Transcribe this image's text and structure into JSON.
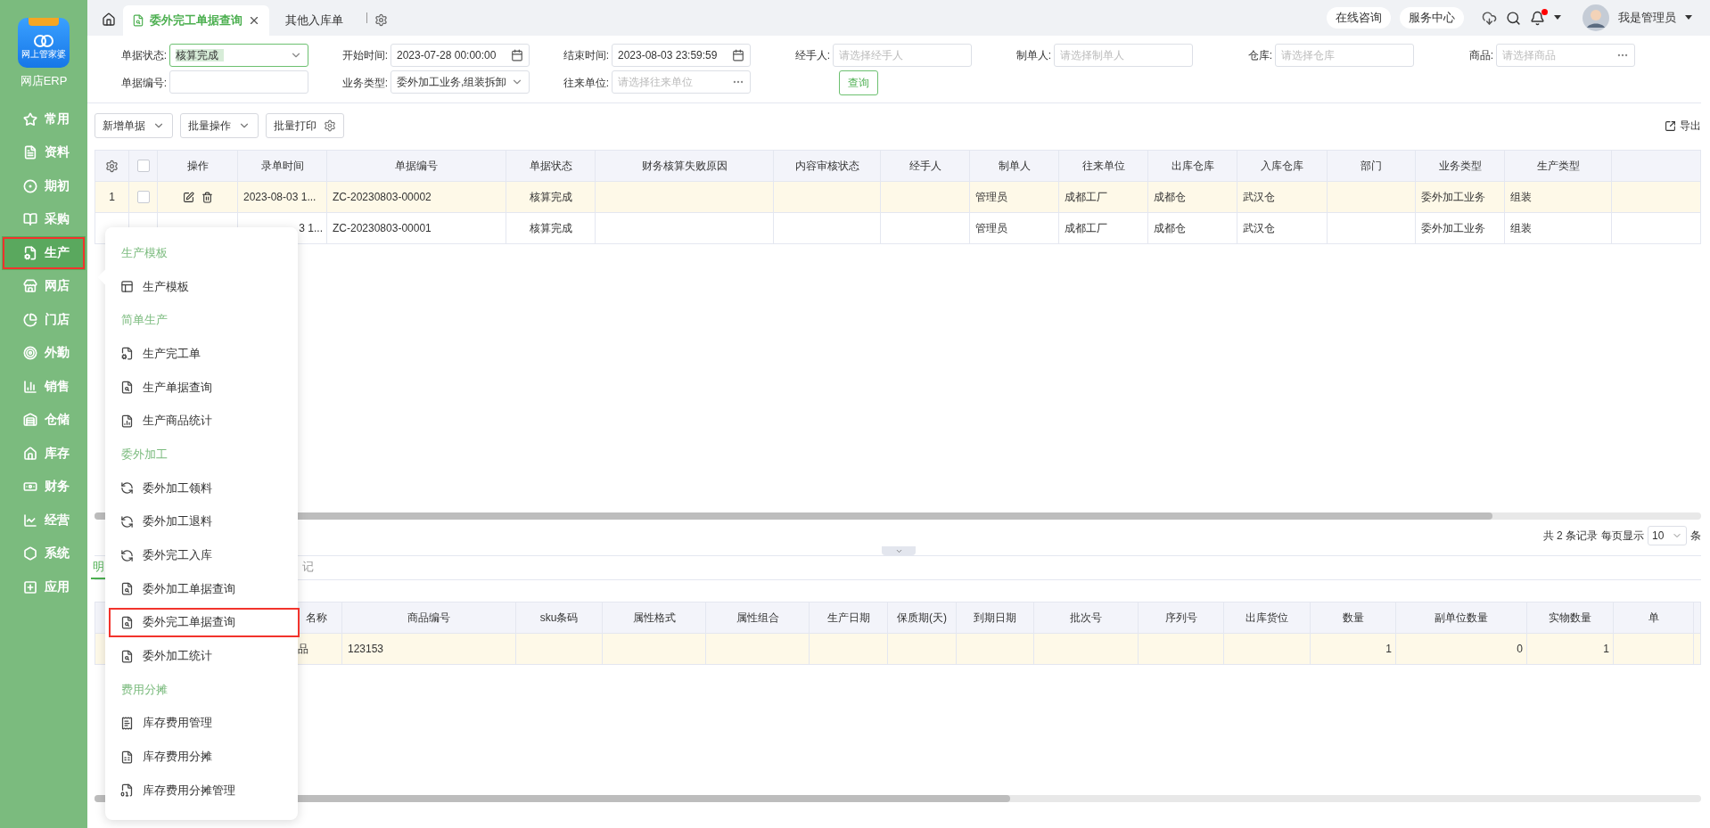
{
  "sidebar": {
    "logo_caption": "网上管家婆",
    "app_name": "网店ERP",
    "items": [
      {
        "label": "常用",
        "selected": false,
        "highlighted": false
      },
      {
        "label": "资料",
        "selected": false,
        "highlighted": false
      },
      {
        "label": "期初",
        "selected": false,
        "highlighted": false
      },
      {
        "label": "采购",
        "selected": false,
        "highlighted": false
      },
      {
        "label": "生产",
        "selected": true,
        "highlighted": true
      },
      {
        "label": "网店",
        "selected": false,
        "highlighted": false
      },
      {
        "label": "门店",
        "selected": false,
        "highlighted": false
      },
      {
        "label": "外勤",
        "selected": false,
        "highlighted": false
      },
      {
        "label": "销售",
        "selected": false,
        "highlighted": false
      },
      {
        "label": "仓储",
        "selected": false,
        "highlighted": false
      },
      {
        "label": "库存",
        "selected": false,
        "highlighted": false
      },
      {
        "label": "财务",
        "selected": false,
        "highlighted": false
      },
      {
        "label": "经营",
        "selected": false,
        "highlighted": false
      },
      {
        "label": "系统",
        "selected": false,
        "highlighted": false
      },
      {
        "label": "应用",
        "selected": false,
        "highlighted": false
      }
    ]
  },
  "tabs": [
    {
      "label": "委外完工单据查询",
      "selected": true
    },
    {
      "label": "其他入库单",
      "selected": false
    }
  ],
  "header": {
    "buttons": [
      "在线咨询",
      "服务中心"
    ],
    "user": "我是管理员",
    "notification": true
  },
  "filters": [
    {
      "label": "单据状态:",
      "kind": "select",
      "value": "核算完成"
    },
    {
      "label": "开始时间:",
      "kind": "date",
      "value": "2023-07-28 00:00:00"
    },
    {
      "label": "结束时间:",
      "kind": "date",
      "value": "2023-08-03 23:59:59"
    },
    {
      "label": "经手人:",
      "kind": "text",
      "placeholder": "请选择经手人"
    },
    {
      "label": "制单人:",
      "kind": "text",
      "placeholder": "请选择制单人"
    },
    {
      "label": "仓库:",
      "kind": "text",
      "placeholder": "请选择仓库"
    },
    {
      "label": "商品:",
      "kind": "picker",
      "placeholder": "请选择商品"
    },
    {
      "label": "单据编号:",
      "kind": "text"
    },
    {
      "label": "业务类型:",
      "kind": "select",
      "value": "委外加工业务,组装拆卸"
    },
    {
      "label": "往来单位:",
      "kind": "picker",
      "placeholder": "请选择往来单位"
    }
  ],
  "query_button": "查询",
  "toolbar": [
    {
      "label": "新增单据",
      "kind": "dropdown"
    },
    {
      "label": "批量操作",
      "kind": "dropdown"
    },
    {
      "label": "批量打印",
      "kind": "settings"
    }
  ],
  "export": "导出",
  "table": {
    "header_checked": false,
    "columns": [
      "操作",
      "录单时间",
      "单据编号",
      "单据状态",
      "财务核算失败原因",
      "内容审核状态",
      "经手人",
      "制单人",
      "往来单位",
      "出库仓库",
      "入库仓库",
      "部门",
      "业务类型",
      "生产类型"
    ],
    "rows": [
      {
        "index": "1",
        "checked": false,
        "actions": true,
        "selected": true,
        "clipped": false,
        "cells": [
          null,
          "2023-08-03 1...",
          "ZC-20230803-00002",
          "核算完成",
          null,
          null,
          null,
          "管理员",
          "成都工厂",
          "成都仓",
          "武汉仓",
          null,
          "委外加工业务",
          "组装"
        ]
      },
      {
        "selected": false,
        "clipped": true,
        "cells": [
          null,
          "3 1...",
          "ZC-20230803-00001",
          "核算完成",
          null,
          null,
          null,
          "管理员",
          "成都工厂",
          "成都仓",
          "武汉仓",
          null,
          "委外加工业务",
          "组装"
        ]
      }
    ]
  },
  "pagination": {
    "total": "共 2 条记录",
    "per_page_label": "每页显示",
    "per_page": "10",
    "unit": "条"
  },
  "detail_tabs": [
    {
      "label": "明",
      "selected": true
    },
    {
      "label": "记",
      "selected": false
    }
  ],
  "detail_table": {
    "columns": [
      "名称",
      "商品编号",
      "sku条码",
      "属性格式",
      "属性组合",
      "生产日期",
      "保质期(天)",
      "到期日期",
      "批次号",
      "序列号",
      "出库货位",
      "数量",
      "副单位数量",
      "实物数量",
      "单"
    ],
    "rows": [
      {
        "selected": true,
        "cells": [
          "品",
          "123153",
          null,
          null,
          null,
          null,
          null,
          null,
          null,
          null,
          null,
          "1",
          "0",
          "1",
          null
        ]
      }
    ]
  },
  "menu": [
    {
      "kind": "heading",
      "label": "生产模板"
    },
    {
      "kind": "item",
      "label": "生产模板",
      "highlighted": false
    },
    {
      "kind": "heading",
      "label": "简单生产"
    },
    {
      "kind": "item",
      "label": "生产完工单",
      "highlighted": false
    },
    {
      "kind": "item",
      "label": "生产单据查询",
      "highlighted": false
    },
    {
      "kind": "item",
      "label": "生产商品统计",
      "highlighted": false
    },
    {
      "kind": "heading",
      "label": "委外加工"
    },
    {
      "kind": "item",
      "label": "委外加工领料",
      "highlighted": false
    },
    {
      "kind": "item",
      "label": "委外加工退料",
      "highlighted": false
    },
    {
      "kind": "item",
      "label": "委外完工入库",
      "highlighted": false
    },
    {
      "kind": "item",
      "label": "委外加工单据查询",
      "highlighted": false
    },
    {
      "kind": "item",
      "label": "委外完工单据查询",
      "highlighted": true
    },
    {
      "kind": "item",
      "label": "委外加工统计",
      "highlighted": false
    },
    {
      "kind": "heading",
      "label": "费用分摊"
    },
    {
      "kind": "item",
      "label": "库存费用管理",
      "highlighted": false
    },
    {
      "kind": "item",
      "label": "库存费用分摊",
      "highlighted": false
    },
    {
      "kind": "item",
      "label": "库存费用分摊管理",
      "highlighted": false
    }
  ]
}
